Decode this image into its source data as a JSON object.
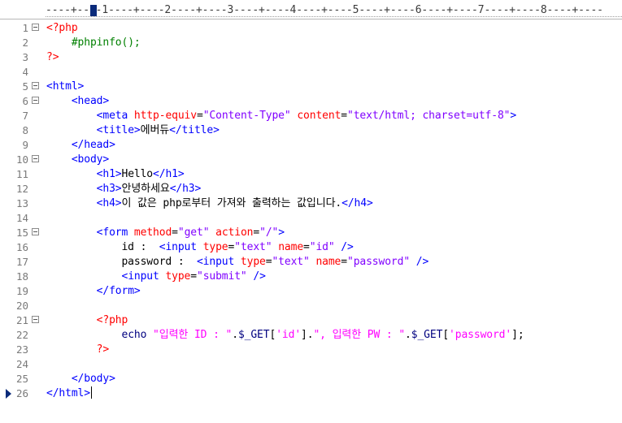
{
  "ruler": {
    "text": "----+----1----+----2----+----3----+----4----+----5----+----6----+----7----+----8----+----"
  },
  "colors": {
    "tag": "#0000ff",
    "attr": "#ff0000",
    "value": "#8000ff",
    "php": "#ff0000",
    "comment": "#008000",
    "string": "#ff00ff",
    "variable": "#000080",
    "text": "#000000"
  },
  "editor": {
    "current_line": 26,
    "lines": [
      {
        "n": "1",
        "fold": true,
        "tokens": [
          [
            "php",
            "<?php"
          ]
        ]
      },
      {
        "n": "2",
        "fold": false,
        "tokens": [
          [
            "txt",
            "    "
          ],
          [
            "cmt",
            "#phpinfo();"
          ]
        ]
      },
      {
        "n": "3",
        "fold": false,
        "tokens": [
          [
            "php",
            "?>"
          ]
        ]
      },
      {
        "n": "4",
        "fold": false,
        "tokens": []
      },
      {
        "n": "5",
        "fold": true,
        "tokens": [
          [
            "tag",
            "<html>"
          ]
        ]
      },
      {
        "n": "6",
        "fold": true,
        "tokens": [
          [
            "txt",
            "    "
          ],
          [
            "tag",
            "<head>"
          ]
        ]
      },
      {
        "n": "7",
        "fold": false,
        "tokens": [
          [
            "txt",
            "        "
          ],
          [
            "tag",
            "<meta "
          ],
          [
            "attr",
            "http-equiv"
          ],
          [
            "txt",
            "="
          ],
          [
            "val",
            "\"Content-Type\""
          ],
          [
            "txt",
            " "
          ],
          [
            "attr",
            "content"
          ],
          [
            "txt",
            "="
          ],
          [
            "val",
            "\"text/html; charset=utf-8\""
          ],
          [
            "tag",
            ">"
          ]
        ]
      },
      {
        "n": "8",
        "fold": false,
        "tokens": [
          [
            "txt",
            "        "
          ],
          [
            "tag",
            "<title>"
          ],
          [
            "txt",
            "에버듀"
          ],
          [
            "tag",
            "</title>"
          ]
        ]
      },
      {
        "n": "9",
        "fold": false,
        "tokens": [
          [
            "txt",
            "    "
          ],
          [
            "tag",
            "</head>"
          ]
        ]
      },
      {
        "n": "10",
        "fold": true,
        "tokens": [
          [
            "txt",
            "    "
          ],
          [
            "tag",
            "<body>"
          ]
        ]
      },
      {
        "n": "11",
        "fold": false,
        "tokens": [
          [
            "txt",
            "        "
          ],
          [
            "tag",
            "<h1>"
          ],
          [
            "txt",
            "Hello"
          ],
          [
            "tag",
            "</h1>"
          ]
        ]
      },
      {
        "n": "12",
        "fold": false,
        "tokens": [
          [
            "txt",
            "        "
          ],
          [
            "tag",
            "<h3>"
          ],
          [
            "txt",
            "안녕하세요"
          ],
          [
            "tag",
            "</h3>"
          ]
        ]
      },
      {
        "n": "13",
        "fold": false,
        "tokens": [
          [
            "txt",
            "        "
          ],
          [
            "tag",
            "<h4>"
          ],
          [
            "txt",
            "이 값은 php로부터 가져와 출력하는 값입니다."
          ],
          [
            "tag",
            "</h4>"
          ]
        ]
      },
      {
        "n": "14",
        "fold": false,
        "tokens": []
      },
      {
        "n": "15",
        "fold": true,
        "tokens": [
          [
            "txt",
            "        "
          ],
          [
            "tag",
            "<form "
          ],
          [
            "attr",
            "method"
          ],
          [
            "txt",
            "="
          ],
          [
            "val",
            "\"get\""
          ],
          [
            "txt",
            " "
          ],
          [
            "attr",
            "action"
          ],
          [
            "txt",
            "="
          ],
          [
            "val",
            "\"/\""
          ],
          [
            "tag",
            ">"
          ]
        ]
      },
      {
        "n": "16",
        "fold": false,
        "tokens": [
          [
            "txt",
            "            id :  "
          ],
          [
            "tag",
            "<input "
          ],
          [
            "attr",
            "type"
          ],
          [
            "txt",
            "="
          ],
          [
            "val",
            "\"text\""
          ],
          [
            "txt",
            " "
          ],
          [
            "attr",
            "name"
          ],
          [
            "txt",
            "="
          ],
          [
            "val",
            "\"id\""
          ],
          [
            "txt",
            " "
          ],
          [
            "tag",
            "/>"
          ]
        ]
      },
      {
        "n": "17",
        "fold": false,
        "tokens": [
          [
            "txt",
            "            password :  "
          ],
          [
            "tag",
            "<input "
          ],
          [
            "attr",
            "type"
          ],
          [
            "txt",
            "="
          ],
          [
            "val",
            "\"text\""
          ],
          [
            "txt",
            " "
          ],
          [
            "attr",
            "name"
          ],
          [
            "txt",
            "="
          ],
          [
            "val",
            "\"password\""
          ],
          [
            "txt",
            " "
          ],
          [
            "tag",
            "/>"
          ]
        ]
      },
      {
        "n": "18",
        "fold": false,
        "tokens": [
          [
            "txt",
            "            "
          ],
          [
            "tag",
            "<input "
          ],
          [
            "attr",
            "type"
          ],
          [
            "txt",
            "="
          ],
          [
            "val",
            "\"submit\""
          ],
          [
            "txt",
            " "
          ],
          [
            "tag",
            "/>"
          ]
        ]
      },
      {
        "n": "19",
        "fold": false,
        "tokens": [
          [
            "txt",
            "        "
          ],
          [
            "tag",
            "</form>"
          ]
        ]
      },
      {
        "n": "20",
        "fold": false,
        "tokens": []
      },
      {
        "n": "21",
        "fold": true,
        "tokens": [
          [
            "txt",
            "        "
          ],
          [
            "php",
            "<?php"
          ]
        ]
      },
      {
        "n": "22",
        "fold": false,
        "tokens": [
          [
            "txt",
            "            "
          ],
          [
            "var",
            "echo"
          ],
          [
            "txt",
            " "
          ],
          [
            "str",
            "\"입력한 ID : \""
          ],
          [
            "txt",
            "."
          ],
          [
            "var",
            "$_GET"
          ],
          [
            "txt",
            "["
          ],
          [
            "str",
            "'id'"
          ],
          [
            "txt",
            "]."
          ],
          [
            "str",
            "\", 입력한 PW : \""
          ],
          [
            "txt",
            "."
          ],
          [
            "var",
            "$_GET"
          ],
          [
            "txt",
            "["
          ],
          [
            "str",
            "'password'"
          ],
          [
            "txt",
            "];"
          ]
        ]
      },
      {
        "n": "23",
        "fold": false,
        "tokens": [
          [
            "txt",
            "        "
          ],
          [
            "php",
            "?>"
          ]
        ]
      },
      {
        "n": "24",
        "fold": false,
        "tokens": []
      },
      {
        "n": "25",
        "fold": false,
        "tokens": [
          [
            "txt",
            "    "
          ],
          [
            "tag",
            "</body>"
          ]
        ]
      },
      {
        "n": "26",
        "fold": false,
        "tokens": [
          [
            "tag",
            "</html>"
          ]
        ]
      }
    ]
  }
}
